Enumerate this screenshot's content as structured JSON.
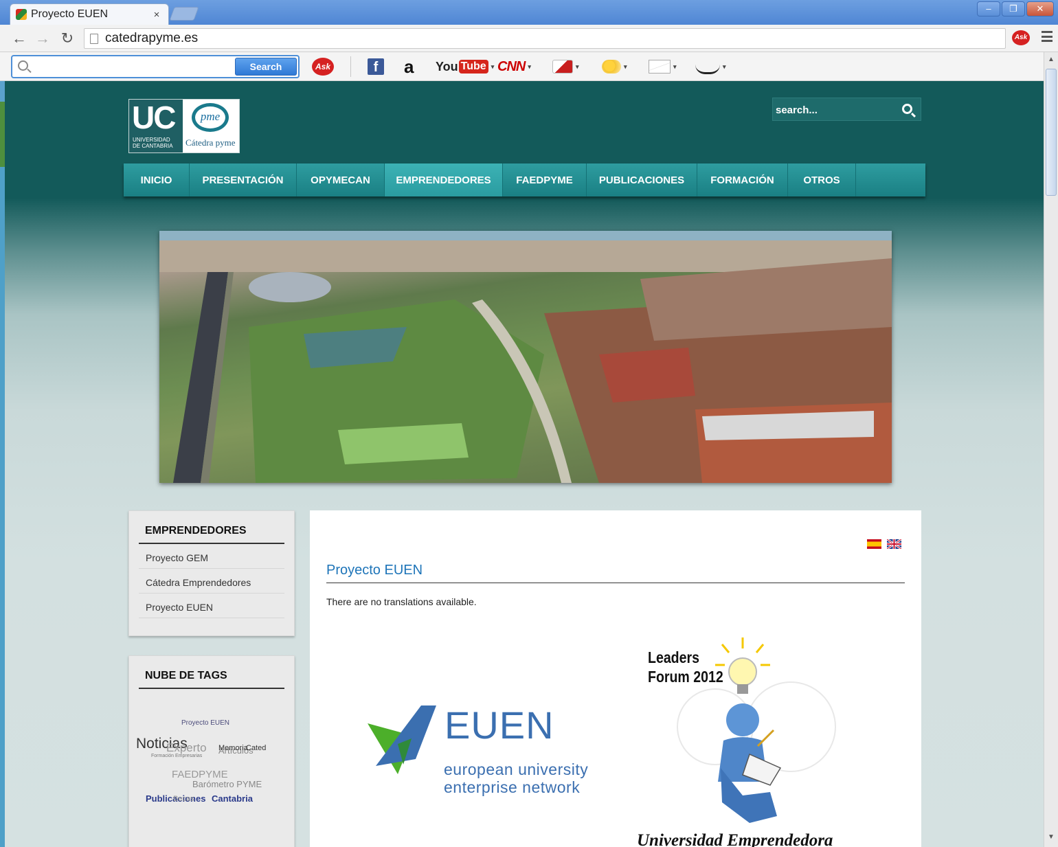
{
  "browser": {
    "tab_title": "Proyecto EUEN",
    "tab_close": "×",
    "url": "catedrapyme.es",
    "window_controls": [
      "–",
      "❐",
      "✕"
    ],
    "ask_label": "Ask"
  },
  "toolbar": {
    "search_button": "Search",
    "ask_label": "Ask",
    "icons": [
      "facebook-icon",
      "amazon-icon",
      "youtube-icon",
      "cnn-icon",
      "games-icon",
      "weather-icon",
      "mail-icon",
      "sign-language-icon"
    ],
    "facebook": "f",
    "amazon": "a",
    "youtube_you": "You",
    "youtube_tube": "Tube",
    "cnn": "CNN",
    "caret": "▾"
  },
  "site": {
    "logo": {
      "uc": "UC",
      "university": "UNIVERSIDAD\nDE CANTABRIA",
      "pyme_mark": "pme",
      "pyme_text": "Cátedra pyme"
    },
    "search_placeholder": "search...",
    "nav": [
      "INICIO",
      "PRESENTACIÓN",
      "OPYMECAN",
      "EMPRENDEDORES",
      "FAEDPYME",
      "PUBLICACIONES",
      "FORMACIÓN",
      "OTROS"
    ],
    "nav_active": "EMPRENDEDORES"
  },
  "sidebar": {
    "emprendedores": {
      "title": "EMPRENDEDORES",
      "items": [
        "Proyecto GEM",
        "Cátedra Emprendedores",
        "Proyecto EUEN"
      ]
    },
    "tags": {
      "title": "NUBE DE TAGS",
      "items": [
        "Proyecto EUEN",
        "Noticias",
        "Experto",
        "Artículos",
        "Memoria",
        "Cated",
        "Formación Empresarias",
        "FAEDPYME",
        "Barómetro PYME",
        "Publicaciones",
        "Cantabria",
        "Becas"
      ]
    }
  },
  "content": {
    "title": "Proyecto EUEN",
    "notice": "There are no translations available.",
    "euen": {
      "name": "EUEN",
      "line1": "european university",
      "line2": "enterprise network"
    },
    "leaders": {
      "title_line1": "Leaders",
      "title_line2": "Forum 2012",
      "footer": "Universidad Emprendedora"
    }
  },
  "colors": {
    "header_bg": "#135a5a",
    "nav_bg": "#1a7f83",
    "title_blue": "#1d74b8",
    "euen_blue": "#3b6fb0",
    "euen_green": "#4caf2a"
  }
}
